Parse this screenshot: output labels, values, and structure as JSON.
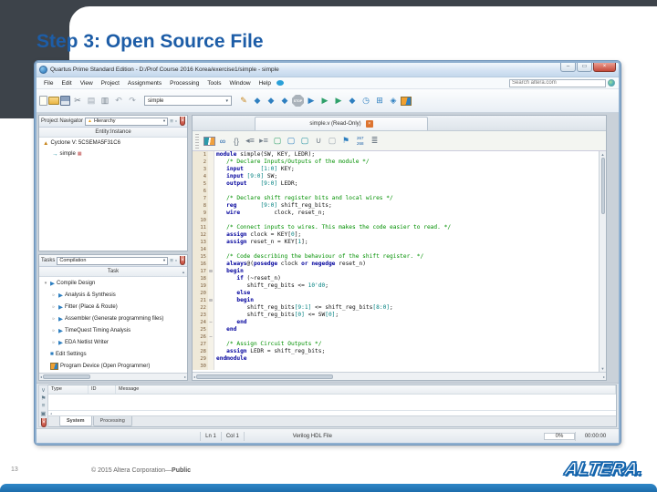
{
  "slide": {
    "title": "Step 3: Open Source File",
    "page_number": "13",
    "copyright": "© 2015 Altera Corporation—",
    "copyright_bold": "Public",
    "logo_text": "ALTERA."
  },
  "window": {
    "title": "Quartus Prime Standard Edition - D:/Prof Course 2016 Korea/exercise1/simple - simple",
    "controls": [
      "minimize",
      "maximize",
      "close"
    ],
    "menu_items": [
      "File",
      "Edit",
      "View",
      "Project",
      "Assignments",
      "Processing",
      "Tools",
      "Window",
      "Help"
    ],
    "search": {
      "placeholder": "Search altera.com"
    },
    "toolbar": {
      "project_select": "simple",
      "left_icons": [
        "new-file",
        "open-project",
        "save",
        "cut",
        "copy",
        "paste",
        "undo",
        "redo"
      ],
      "right_icons": [
        "edit-pencil",
        "assignment-diamond",
        "pin-diamond",
        "settings-diamond",
        "stop",
        "start-compilation",
        "start-analysis",
        "start-task",
        "rapid-recompile",
        "timing-analyzer",
        "hierarchy-viewer",
        "netlist-viewer",
        "programmer"
      ]
    }
  },
  "project_navigator": {
    "label": "Project Navigator",
    "view_select": "Hierarchy",
    "header_buttons": [
      "list",
      "pin",
      "close"
    ],
    "column_header": "Entity:Instance",
    "tree": [
      {
        "label": "Cyclone V: 5CSEMA5F31C6",
        "level": 0,
        "icon": "device-triangle"
      },
      {
        "label": "simple",
        "level": 1,
        "icon": "entity-arrow"
      }
    ]
  },
  "tasks": {
    "label": "Tasks",
    "view_select": "Compilation",
    "header_buttons": [
      "list",
      "pin",
      "close"
    ],
    "column_header": "Task",
    "rows": [
      {
        "label": "Compile Design",
        "level": 0,
        "expander": "expanded",
        "icon": "run-arrow"
      },
      {
        "label": "Analysis & Synthesis",
        "level": 1,
        "expander": "collapsed",
        "icon": "run-arrow"
      },
      {
        "label": "Fitter (Place & Route)",
        "level": 1,
        "expander": "collapsed",
        "icon": "run-arrow"
      },
      {
        "label": "Assembler (Generate programming files)",
        "level": 1,
        "expander": "collapsed",
        "icon": "run-arrow"
      },
      {
        "label": "TimeQuest Timing Analysis",
        "level": 1,
        "expander": "collapsed",
        "icon": "run-arrow"
      },
      {
        "label": "EDA Netlist Writer",
        "level": 1,
        "expander": "collapsed",
        "icon": "run-arrow"
      },
      {
        "label": "Edit Settings",
        "level": 0,
        "expander": "none",
        "icon": "settings-square"
      },
      {
        "label": "Program Device (Open Programmer)",
        "level": 0,
        "expander": "none",
        "icon": "programmer-small"
      }
    ]
  },
  "editor": {
    "tab_title": "simple.v (Read-Only)",
    "toolbar_icons": [
      "split-pane",
      "find",
      "replace",
      "indent-decrease",
      "indent-increase",
      "bookmark-new",
      "bookmark-copy",
      "bookmark-paste",
      "attach-file",
      "note-disabled",
      "goto-flag"
    ],
    "toolbar_icons_right": [
      "line-wrap"
    ],
    "bookmark_counts": [
      "267",
      "268"
    ],
    "code_lines": [
      {
        "n": 1,
        "s": [
          [
            "k",
            "module"
          ],
          [
            "p",
            " simple(SW, KEY, LEDR);"
          ]
        ]
      },
      {
        "n": 2,
        "s": [
          [
            "c",
            "   /* Declare Inputs/Outputs of the module */"
          ]
        ]
      },
      {
        "n": 3,
        "s": [
          [
            "k",
            "   input"
          ],
          [
            "p",
            "     "
          ],
          [
            "n",
            "[1:0]"
          ],
          [
            "p",
            " KEY;"
          ]
        ]
      },
      {
        "n": 4,
        "s": [
          [
            "k",
            "   input"
          ],
          [
            "p",
            " "
          ],
          [
            "n",
            "[9:0]"
          ],
          [
            "p",
            " SW;"
          ]
        ]
      },
      {
        "n": 5,
        "s": [
          [
            "k",
            "   output"
          ],
          [
            "p",
            "    "
          ],
          [
            "n",
            "[9:0]"
          ],
          [
            "p",
            " LEDR;"
          ]
        ]
      },
      {
        "n": 6,
        "s": []
      },
      {
        "n": 7,
        "s": [
          [
            "c",
            "   /* Declare shift register bits and local wires */"
          ]
        ]
      },
      {
        "n": 8,
        "s": [
          [
            "k",
            "   reg"
          ],
          [
            "p",
            "       "
          ],
          [
            "n",
            "[9:0]"
          ],
          [
            "p",
            " shift_reg_bits;"
          ]
        ]
      },
      {
        "n": 9,
        "s": [
          [
            "k",
            "   wire"
          ],
          [
            "p",
            "          clock, reset_n;"
          ]
        ]
      },
      {
        "n": 10,
        "s": []
      },
      {
        "n": 11,
        "s": [
          [
            "c",
            "   /* Connect inputs to wires. This makes the code easier to read. */"
          ]
        ]
      },
      {
        "n": 12,
        "s": [
          [
            "k",
            "   assign"
          ],
          [
            "p",
            " clock = KEY["
          ],
          [
            "n",
            "0"
          ],
          [
            "p",
            "];"
          ]
        ]
      },
      {
        "n": 13,
        "s": [
          [
            "k",
            "   assign"
          ],
          [
            "p",
            " reset_n = KEY["
          ],
          [
            "n",
            "1"
          ],
          [
            "p",
            "];"
          ]
        ]
      },
      {
        "n": 14,
        "s": []
      },
      {
        "n": 15,
        "s": [
          [
            "c",
            "   /* Code describing the behaviour of the shift register. */"
          ]
        ]
      },
      {
        "n": 16,
        "s": [
          [
            "k",
            "   always"
          ],
          [
            "p",
            "@("
          ],
          [
            "k",
            "posedge"
          ],
          [
            "p",
            " clock "
          ],
          [
            "k",
            "or"
          ],
          [
            "p",
            " "
          ],
          [
            "k",
            "negedge"
          ],
          [
            "p",
            " reset_n)"
          ]
        ]
      },
      {
        "n": 17,
        "f": 1,
        "s": [
          [
            "k",
            "   begin"
          ]
        ]
      },
      {
        "n": 18,
        "s": [
          [
            "p",
            "      "
          ],
          [
            "k",
            "if"
          ],
          [
            "p",
            " (~reset_n)"
          ]
        ]
      },
      {
        "n": 19,
        "s": [
          [
            "p",
            "         shift_reg_bits <= "
          ],
          [
            "n",
            "10'd0"
          ],
          [
            "p",
            ";"
          ]
        ]
      },
      {
        "n": 20,
        "s": [
          [
            "p",
            "      "
          ],
          [
            "k",
            "else"
          ]
        ]
      },
      {
        "n": 21,
        "f": 1,
        "s": [
          [
            "p",
            "      "
          ],
          [
            "k",
            "begin"
          ]
        ]
      },
      {
        "n": 22,
        "s": [
          [
            "p",
            "         shift_reg_bits"
          ],
          [
            "n",
            "[9:1]"
          ],
          [
            "p",
            " <= shift_reg_bits"
          ],
          [
            "n",
            "[8:0]"
          ],
          [
            "p",
            ";"
          ]
        ]
      },
      {
        "n": 23,
        "s": [
          [
            "p",
            "         shift_reg_bits"
          ],
          [
            "n",
            "[0]"
          ],
          [
            "p",
            " <= SW"
          ],
          [
            "n",
            "[0]"
          ],
          [
            "p",
            ";"
          ]
        ]
      },
      {
        "n": 24,
        "f": 2,
        "s": [
          [
            "p",
            "      "
          ],
          [
            "k",
            "end"
          ]
        ]
      },
      {
        "n": 25,
        "s": [
          [
            "k",
            "   end"
          ]
        ]
      },
      {
        "n": 26,
        "f": 2,
        "s": []
      },
      {
        "n": 27,
        "s": [
          [
            "c",
            "   /* Assign Circuit Outputs */"
          ]
        ]
      },
      {
        "n": 28,
        "s": [
          [
            "k",
            "   assign"
          ],
          [
            "p",
            " LEDR = shift_reg_bits;"
          ]
        ]
      },
      {
        "n": 29,
        "s": [
          [
            "k",
            "endmodule"
          ]
        ]
      },
      {
        "n": 30,
        "s": []
      }
    ]
  },
  "messages": {
    "tool_icons": [
      "chevron",
      "flag",
      "list",
      "window",
      "close"
    ],
    "columns": [
      "Type",
      "ID",
      "Message"
    ],
    "tabs": [
      {
        "label": "System",
        "active": true
      },
      {
        "label": "Processing",
        "active": false
      }
    ]
  },
  "status": {
    "ln": "Ln 1",
    "col": "Col 1",
    "file_type": "Verilog HDL File",
    "progress": "0%",
    "elapsed": "00:00:00"
  }
}
